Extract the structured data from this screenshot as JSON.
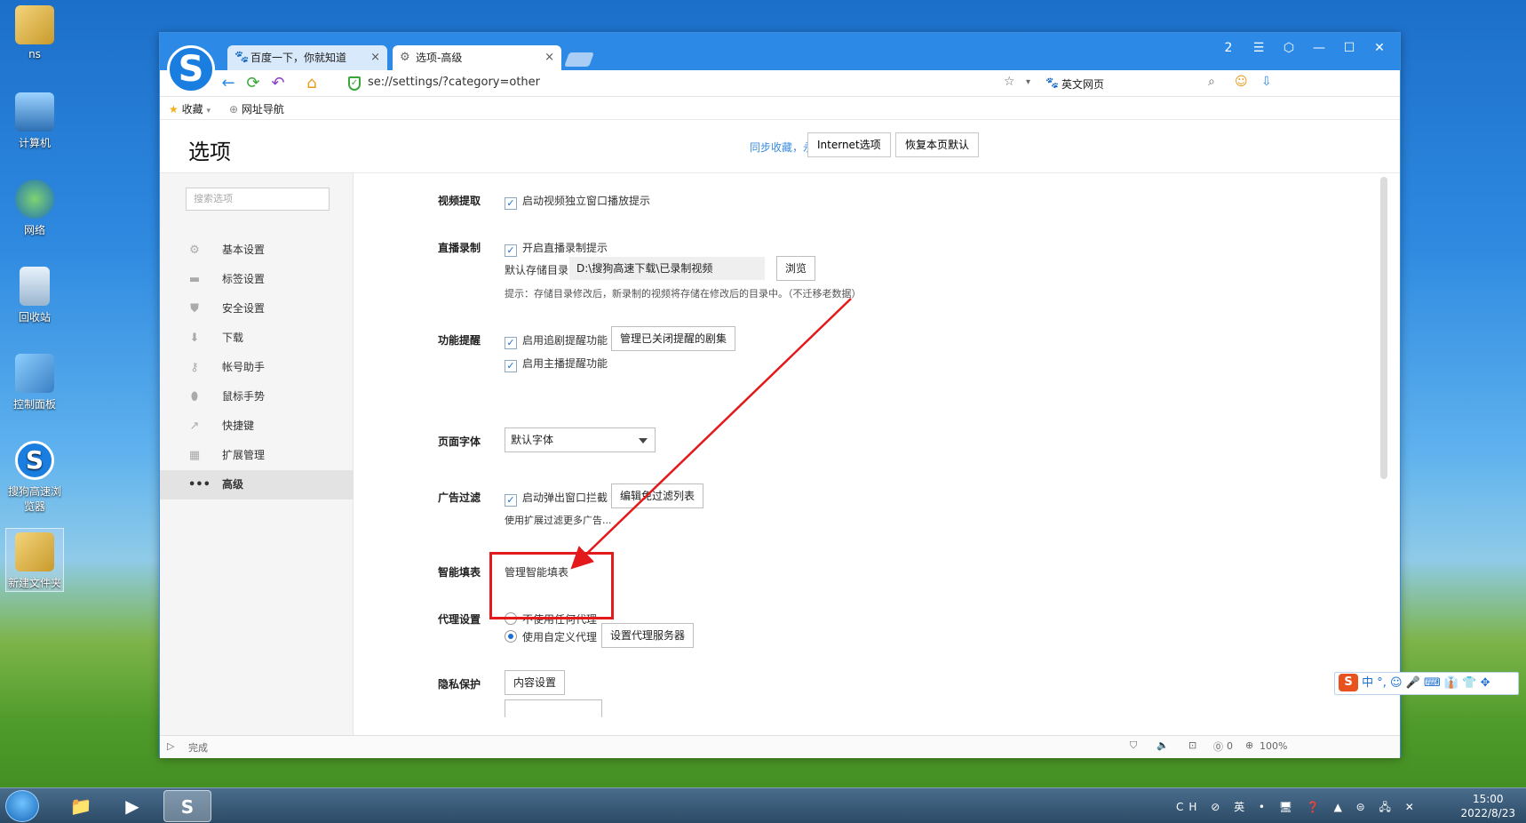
{
  "desktop": {
    "icons": [
      {
        "label": "ns"
      },
      {
        "label": "计算机"
      },
      {
        "label": "网络"
      },
      {
        "label": "回收站"
      },
      {
        "label": "控制面板"
      },
      {
        "label": "搜狗高速浏览器"
      },
      {
        "label": "新建文件夹"
      }
    ]
  },
  "browser": {
    "logo": "S",
    "tabs": [
      {
        "title": "百度一下，你就知道",
        "close": "×"
      },
      {
        "title": "选项-高级",
        "close": "×"
      }
    ],
    "window_controls": [
      "2",
      "☰",
      "⬡",
      "—",
      "☐",
      "✕"
    ],
    "url": "se://settings/?category=other",
    "search_engine_label": "英文网页",
    "bookmarks": [
      {
        "label": "收藏"
      },
      {
        "label": "网址导航"
      }
    ]
  },
  "settings": {
    "title": "选项",
    "sync_link": "同步收藏，永不丢失",
    "internet_options_button": "Internet选项",
    "restore_default_button": "恢复本页默认",
    "search_placeholder": "搜索选项",
    "sidebar": [
      {
        "label": "基本设置",
        "icon": "gear-icon"
      },
      {
        "label": "标签设置",
        "icon": "tab-icon"
      },
      {
        "label": "安全设置",
        "icon": "shield-icon"
      },
      {
        "label": "下载",
        "icon": "download-icon"
      },
      {
        "label": "帐号助手",
        "icon": "key-icon"
      },
      {
        "label": "鼠标手势",
        "icon": "mouse-icon"
      },
      {
        "label": "快捷键",
        "icon": "shortcut-icon"
      },
      {
        "label": "扩展管理",
        "icon": "extension-icon"
      },
      {
        "label": "高级",
        "icon": "more-icon",
        "active": true
      }
    ],
    "sections": {
      "video": {
        "label": "视频提取",
        "option": "启动视频独立窗口播放提示",
        "checked": true
      },
      "live_record": {
        "label": "直播录制",
        "option": "开启直播录制提示",
        "checked": true,
        "dir_label": "默认存储目录",
        "dir_value": "D:\\搜狗高速下载\\已录制视频",
        "browse_button": "浏览",
        "hint": "提示：存储目录修改后，新录制的视频将存储在修改后的目录中。（不迁移老数据）"
      },
      "reminder": {
        "label": "功能提醒",
        "option1": "启用追剧提醒功能",
        "option2": "启用主播提醒功能",
        "manage_button": "管理已关闭提醒的剧集"
      },
      "font": {
        "label": "页面字体",
        "value": "默认字体"
      },
      "adblock": {
        "label": "广告过滤",
        "option": "启动弹出窗口拦截",
        "edit_button": "编辑免过滤列表",
        "more": "使用扩展过滤更多广告..."
      },
      "autofill": {
        "label": "智能填表",
        "link": "管理智能填表"
      },
      "proxy": {
        "label": "代理设置",
        "option1": "不使用任何代理",
        "option2": "使用自定义代理",
        "selected": "使用自定义代理",
        "button": "设置代理服务器"
      },
      "privacy": {
        "label": "隐私保护",
        "button": "内容设置"
      }
    }
  },
  "statusbar": {
    "status": "完成",
    "zoom": "100%",
    "counter": "0"
  },
  "ime": {
    "logo": "S",
    "items": "中 °, ☺ 🎤 ⌨ 👔 👕 ✥"
  },
  "taskbar": {
    "time": "15:00",
    "date": "2022/8/23",
    "tray": "CH ⊘ 英 • 🖥 ❓ ▲ ⊜ 🖧 ✕"
  },
  "colors": {
    "accent": "#2c8ae6",
    "highlight_box": "#e3191b",
    "arrow": "#e3191b",
    "link": "#3a8de0"
  }
}
